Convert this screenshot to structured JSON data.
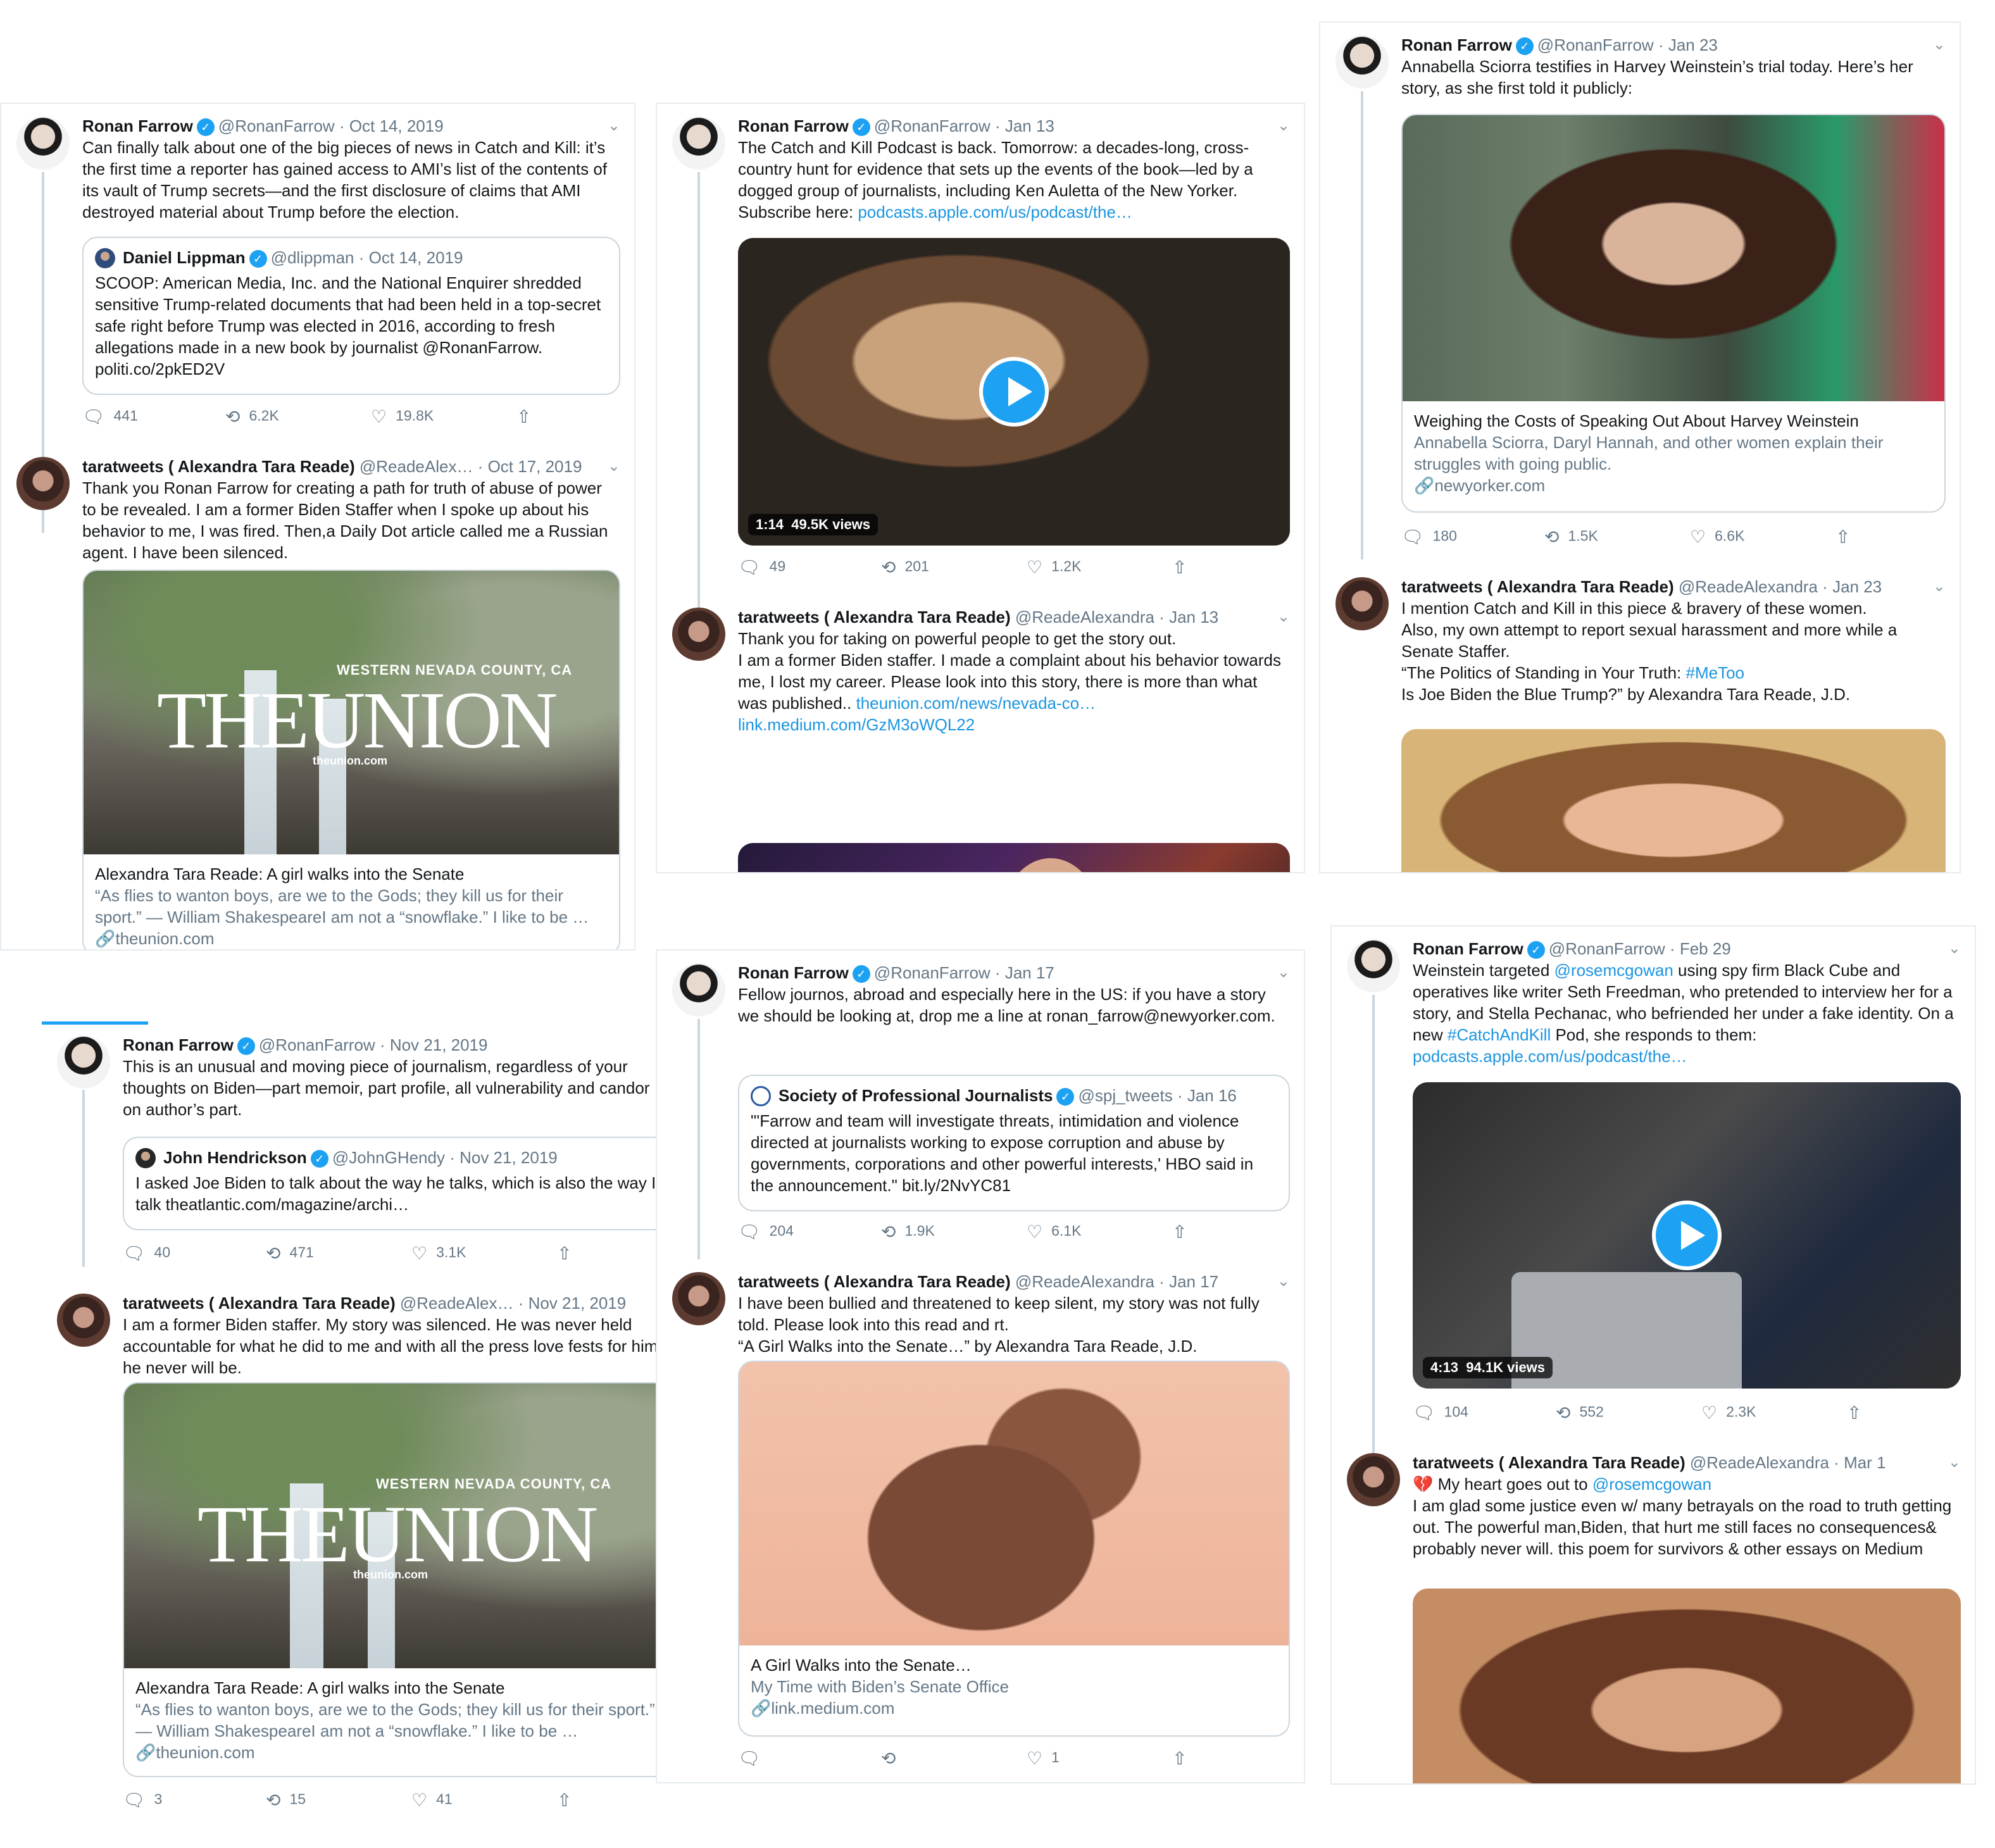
{
  "panels": [
    {
      "tweet1": {
        "name": "Ronan Farrow",
        "handle": "@RonanFarrow",
        "date": "Oct 14, 2019",
        "text": "Can finally talk about one of the big pieces of news in Catch and Kill: it’s the first time a reporter has gained access to AMI’s list of the contents of its vault of Trump secrets—and the first disclosure of claims that AMI destroyed material about Trump before the election.",
        "quote": {
          "name": "Daniel Lippman",
          "handle": "@dlippman",
          "date": "Oct 14, 2019",
          "text": "SCOOP: American Media, Inc. and the National Enquirer shredded sensitive Trump-related documents that had been held in a top-secret safe right before Trump was elected in 2016, according to fresh allegations made in a new book by journalist @RonanFarrow. politi.co/2pkED2V"
        },
        "replies": "441",
        "retweets": "6.2K",
        "likes": "19.8K"
      },
      "tweet2": {
        "name": "taratweets ( Alexandra Tara Reade)",
        "handle": "@ReadeAlex…",
        "date": "Oct 17, 2019",
        "text": "Thank you Ronan Farrow for creating a path for truth of abuse of power to be revealed. I am a former Biden Staffer when I spoke up about his behavior to me, I was fired. Then,a Daily Dot article called me a Russian agent. I have been silenced.",
        "card": {
          "img_small": "WESTERN NEVADA COUNTY, CA",
          "img_big": "THEUNION",
          "img_url": "theunion.com",
          "title": "Alexandra Tara Reade: A girl walks into the Senate",
          "desc": "“As flies to wanton boys, are we to the Gods; they kill us for their sport.” — William ShakespeareI am not a “snowflake.” I like to be …",
          "domain": "theunion.com"
        }
      }
    },
    {
      "tweet1": {
        "name": "Ronan Farrow",
        "handle": "@RonanFarrow",
        "date": "Jan 13",
        "text": "The Catch and Kill Podcast is back. Tomorrow: a decades-long, cross-country hunt for evidence that sets up the events of the book—led by a dogged group of journalists, including Ken Auletta of the New Yorker. Subscribe here: ",
        "link": "podcasts.apple.com/us/podcast/the…",
        "video_time": "1:14",
        "video_views": "49.5K views",
        "replies": "49",
        "retweets": "201",
        "likes": "1.2K"
      },
      "tweet2": {
        "name": "taratweets ( Alexandra Tara Reade)",
        "handle": "@ReadeAlexandra",
        "date": "Jan 13",
        "text1": "Thank you for taking on powerful people to get the story out.",
        "text2": "I am a former Biden staffer. I made a complaint about his behavior towards me, I lost my career. Please look into this story, there is more than what was published.. ",
        "link1": "theunion.com/news/nevada-co…",
        "link2": "link.medium.com/GzM3oWQL22"
      }
    },
    {
      "tweet1": {
        "name": "Ronan Farrow",
        "handle": "@RonanFarrow",
        "date": "Jan 23",
        "text": "Annabella Sciorra testifies in Harvey Weinstein’s trial today. Here’s her story, as she first told it publicly:",
        "card": {
          "title": "Weighing the Costs of Speaking Out About Harvey Weinstein",
          "desc": "Annabella Sciorra, Daryl Hannah, and other women explain their struggles with going public.",
          "domain": "newyorker.com"
        },
        "replies": "180",
        "retweets": "1.5K",
        "likes": "6.6K"
      },
      "tweet2": {
        "name": "taratweets ( Alexandra Tara Reade)",
        "handle": "@ReadeAlexandra",
        "date": "Jan 23",
        "text1": "I mention Catch and Kill in this piece & bravery of these women.",
        "text2": "Also, my own attempt to report sexual harassment and more while a Senate Staffer.",
        "text3a": " “The Politics of Standing in Your Truth: ",
        "hashtag": "#MeToo",
        "text4": " Is Joe Biden the Blue Trump?” by Alexandra Tara Reade, J.D."
      }
    },
    {
      "tweet1": {
        "name": "Ronan Farrow",
        "handle": "@RonanFarrow",
        "date": "Nov 21, 2019",
        "text": "This is an unusual and moving piece of journalism, regardless of your thoughts on Biden—part memoir, part profile, all vulnerability and candor on author’s part.",
        "quote": {
          "name": "John Hendrickson",
          "handle": "@JohnGHendy",
          "date": "Nov 21, 2019",
          "text": "I asked Joe Biden to talk about the way he talks, which is also the way I talk theatlantic.com/magazine/archi…"
        },
        "replies": "40",
        "retweets": "471",
        "likes": "3.1K"
      },
      "tweet2": {
        "name": "taratweets ( Alexandra Tara Reade)",
        "handle": "@ReadeAlex…",
        "date": "Nov 21, 2019",
        "text": "I am a former Biden staffer. My story was silenced. He was never held accountable for what he did to me and with all the press love fests for him, he never will be.",
        "card": {
          "img_small": "WESTERN NEVADA COUNTY, CA",
          "img_big": "THEUNION",
          "img_url": "theunion.com",
          "title": "Alexandra Tara Reade: A girl walks into the Senate",
          "desc": "“As flies to wanton boys, are we to the Gods; they kill us for their sport.” — William ShakespeareI am not a “snowflake.” I like to be …",
          "domain": "theunion.com"
        },
        "replies": "3",
        "retweets": "15",
        "likes": "41"
      }
    },
    {
      "tweet1": {
        "name": "Ronan Farrow",
        "handle": "@RonanFarrow",
        "date": "Jan 17",
        "text": "Fellow journos, abroad and especially here in the US: if you have a story we should be looking at, drop me a line at ronan_farrow@newyorker.com.",
        "quote": {
          "name": "Society of Professional Journalists",
          "handle": "@spj_tweets",
          "date": "Jan 16",
          "text": "\"'Farrow and team will investigate threats, intimidation and violence directed at journalists working to expose corruption and abuse by governments, corporations and other powerful interests,' HBO said in the announcement.\" bit.ly/2NvYC81"
        },
        "replies": "204",
        "retweets": "1.9K",
        "likes": "6.1K"
      },
      "tweet2": {
        "name": "taratweets ( Alexandra Tara Reade)",
        "handle": "@ReadeAlexandra",
        "date": "Jan 17",
        "text1": "I have been bullied and threatened to keep silent, my story was not fully told. Please look into this read and rt.",
        "text2": "“A Girl Walks into the Senate…” by Alexandra Tara Reade, J.D.",
        "card": {
          "title": "A Girl Walks into the Senate…",
          "desc": "My Time with Biden’s Senate Office",
          "domain": "link.medium.com"
        },
        "likes": "1"
      }
    },
    {
      "tweet1": {
        "name": "Ronan Farrow",
        "handle": "@RonanFarrow",
        "date": "Feb 29",
        "text_a": "Weinstein targeted ",
        "mention": "@rosemcgowan",
        "text_b": " using spy firm Black Cube and operatives like writer Seth Freedman, who pretended to interview her for a story, and Stella Pechanac, who befriended her under a fake identity. On a new ",
        "hashtag": "#CatchAndKill",
        "text_c": " Pod, she responds to them:",
        "link": "podcasts.apple.com/us/podcast/the…",
        "video_time": "4:13",
        "video_views": "94.1K views",
        "replies": "104",
        "retweets": "552",
        "likes": "2.3K"
      },
      "tweet2": {
        "name": "taratweets ( Alexandra Tara Reade)",
        "handle": "@ReadeAlexandra",
        "date": "Mar 1",
        "text_a": "💔 My heart goes out to ",
        "mention": "@rosemcgowan",
        "text_b": "I am glad some justice even w/ many betrayals on the road to truth getting out. The powerful man,Biden,  that hurt me still faces no consequences& probably never will. this poem for survivors  & other essays on Medium"
      }
    }
  ]
}
